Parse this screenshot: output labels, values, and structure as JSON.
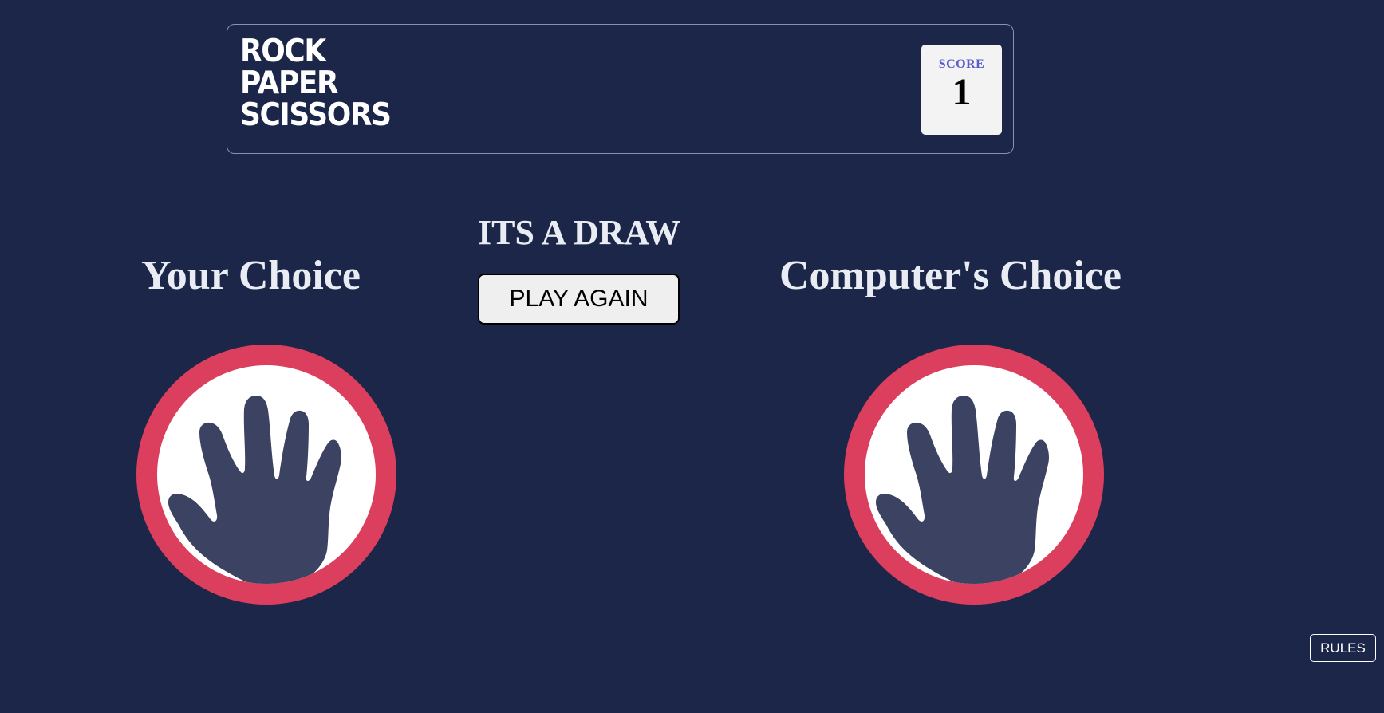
{
  "header": {
    "logo_lines": [
      "ROCK",
      "PAPER",
      "SCISSORS"
    ],
    "score_label": "SCORE",
    "score_value": "1"
  },
  "game": {
    "your_choice_title": "Your Choice",
    "computer_choice_title": "Computer's Choice",
    "result": "ITS A DRAW",
    "play_again_label": "PLAY AGAIN",
    "your_choice": "paper",
    "computer_choice": "paper"
  },
  "footer": {
    "rules_label": "RULES"
  },
  "colors": {
    "background": "#1b2649",
    "paper_ring": "#dc3f5e",
    "hand": "#3b4262",
    "score_label": "#5a5bc9"
  },
  "icons": {
    "your_choice_icon": "paper-hand-icon",
    "computer_choice_icon": "paper-hand-icon"
  }
}
